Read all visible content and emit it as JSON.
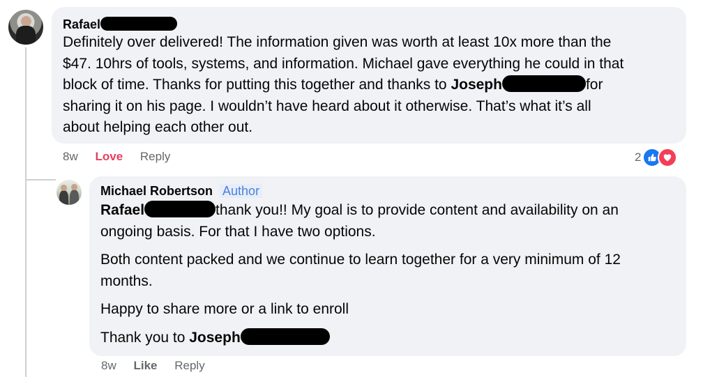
{
  "comment1": {
    "author": "Rafael",
    "line1": "Definitely over delivered! The information given was worth at least 10x more than the",
    "line2": "$47. 10hrs of tools, systems, and information. Michael gave everything he could in that",
    "line3_a": "block of time. Thanks for putting this together and thanks to ",
    "line3_mention": "Joseph",
    "line3_b": "for",
    "line4": "sharing it on his page. I wouldn’t have heard about it otherwise. That’s what it’s all",
    "line5": "about helping each other out.",
    "time": "8w",
    "reaction_label": "Love",
    "reply_label": "Reply",
    "reaction_count": "2",
    "reaction_icons": [
      "like-icon",
      "love-icon"
    ],
    "colors": {
      "like": "#1877f2",
      "love": "#f33e58"
    }
  },
  "reply1": {
    "author": "Michael Robertson",
    "badge": "Author",
    "p1_mention": "Rafael",
    "p1_line1": "thank you!! My goal is to provide content and availability on an",
    "p1_line2": "ongoing basis. For that I have two options.",
    "p2_line1": "Both content packed and we continue to learn together for a very minimum of 12",
    "p2_line2": "months.",
    "p3": "Happy to share more or a link to enroll",
    "p4_text": "Thank you to ",
    "p4_mention": "Joseph",
    "time": "8w",
    "like_label": "Like",
    "reply_label": "Reply"
  }
}
